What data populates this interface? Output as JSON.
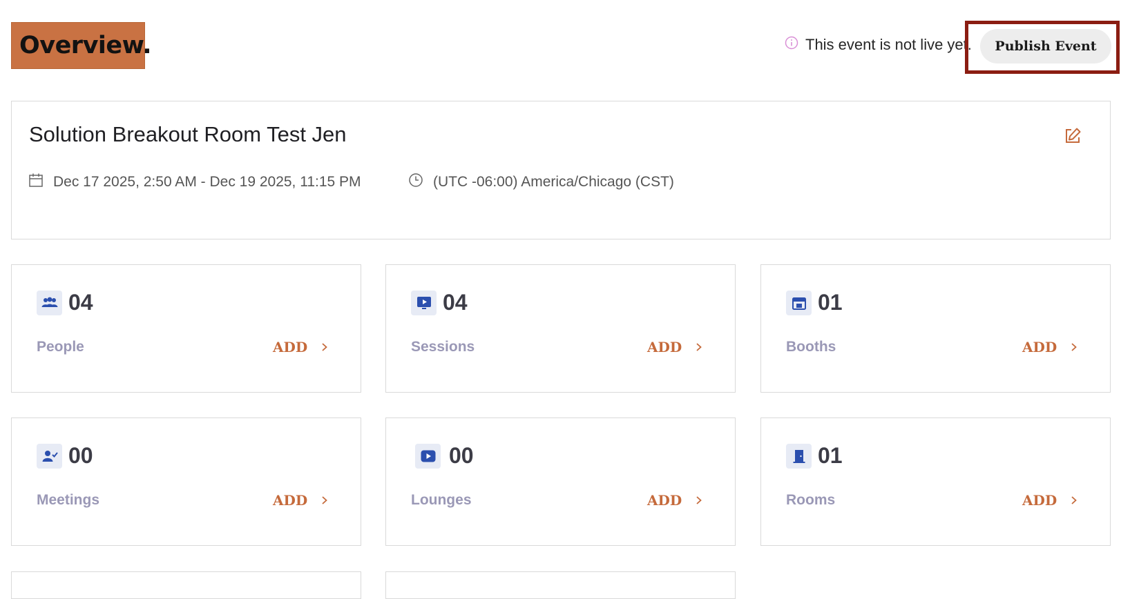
{
  "header": {
    "title": "Overview.",
    "status_text": "This event is not live yet.",
    "publish_label": "Publish Event"
  },
  "event": {
    "name": "Solution Breakout Room Test Jen",
    "date_range": "Dec 17 2025, 2:50 AM - Dec 19 2025, 11:15 PM",
    "timezone": "(UTC -06:00) America/Chicago (CST)"
  },
  "stats": [
    {
      "icon": "people-icon",
      "count": "04",
      "label": "People",
      "add_label": "ADD"
    },
    {
      "icon": "sessions-icon",
      "count": "04",
      "label": "Sessions",
      "add_label": "ADD"
    },
    {
      "icon": "booth-icon",
      "count": "01",
      "label": "Booths",
      "add_label": "ADD"
    },
    {
      "icon": "meetings-icon",
      "count": "00",
      "label": "Meetings",
      "add_label": "ADD"
    },
    {
      "icon": "lounges-icon",
      "count": "00",
      "label": "Lounges",
      "add_label": "ADD"
    },
    {
      "icon": "rooms-icon",
      "count": "01",
      "label": "Rooms",
      "add_label": "ADD"
    }
  ],
  "colors": {
    "accent": "#c56a3b",
    "title_badge": "#c97243",
    "highlight_border": "#8b1d12",
    "icon_blue": "#2b4fae",
    "icon_bg": "#e7ebf5",
    "label_muted": "#9a98b6"
  }
}
